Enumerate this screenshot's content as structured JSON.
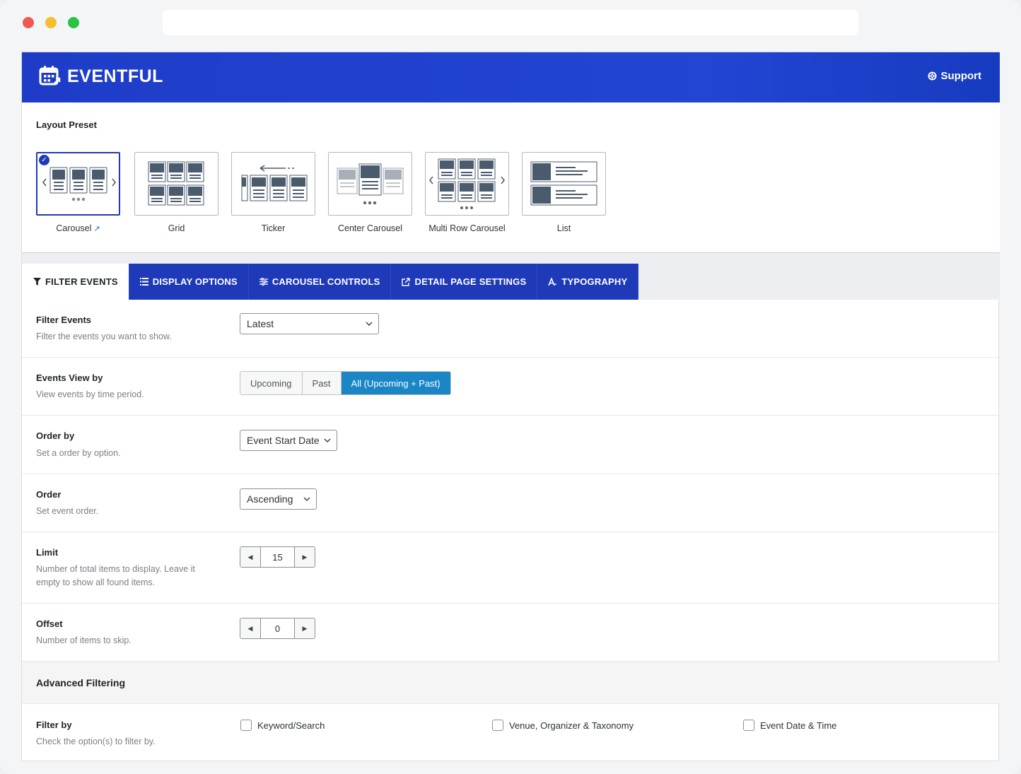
{
  "brand": {
    "name": "EVENTFUL"
  },
  "header": {
    "support_label": "Support"
  },
  "layout_preset": {
    "title": "Layout Preset",
    "items": [
      {
        "label": "Carousel",
        "selected": true,
        "icon": "carousel-layout-icon"
      },
      {
        "label": "Grid",
        "selected": false,
        "icon": "grid-layout-icon"
      },
      {
        "label": "Ticker",
        "selected": false,
        "icon": "ticker-layout-icon"
      },
      {
        "label": "Center Carousel",
        "selected": false,
        "icon": "center-carousel-layout-icon"
      },
      {
        "label": "Multi Row Carousel",
        "selected": false,
        "icon": "multi-row-carousel-layout-icon"
      },
      {
        "label": "List",
        "selected": false,
        "icon": "list-layout-icon"
      }
    ]
  },
  "tabs": [
    {
      "label": "FILTER EVENTS",
      "icon": "filter-icon",
      "active": true
    },
    {
      "label": "DISPLAY OPTIONS",
      "icon": "list-icon",
      "active": false
    },
    {
      "label": "CAROUSEL CONTROLS",
      "icon": "sliders-icon",
      "active": false
    },
    {
      "label": "DETAIL PAGE SETTINGS",
      "icon": "external-link-icon",
      "active": false
    },
    {
      "label": "TYPOGRAPHY",
      "icon": "typography-icon",
      "active": false
    }
  ],
  "fields": {
    "filter_events": {
      "title": "Filter Events",
      "desc": "Filter the events you want to show.",
      "value": "Latest"
    },
    "events_view_by": {
      "title": "Events View by",
      "desc": "View events by time period.",
      "options": [
        "Upcoming",
        "Past",
        "All (Upcoming + Past)"
      ],
      "selected": "All (Upcoming + Past)"
    },
    "order_by": {
      "title": "Order by",
      "desc": "Set a order by option.",
      "value": "Event Start Date"
    },
    "order": {
      "title": "Order",
      "desc": "Set event order.",
      "value": "Ascending"
    },
    "limit": {
      "title": "Limit",
      "desc": "Number of total items to display. Leave it empty to show all found items.",
      "value": "15"
    },
    "offset": {
      "title": "Offset",
      "desc": "Number of items to skip.",
      "value": "0"
    }
  },
  "advanced": {
    "title": "Advanced Filtering",
    "filter_by": {
      "title": "Filter by",
      "desc": "Check the option(s) to filter by.",
      "options": [
        "Keyword/Search",
        "Venue, Organizer & Taxonomy",
        "Event Date & Time"
      ]
    }
  },
  "colors": {
    "brand_blue": "#1f3ab8",
    "accent_blue": "#1b86c6"
  }
}
